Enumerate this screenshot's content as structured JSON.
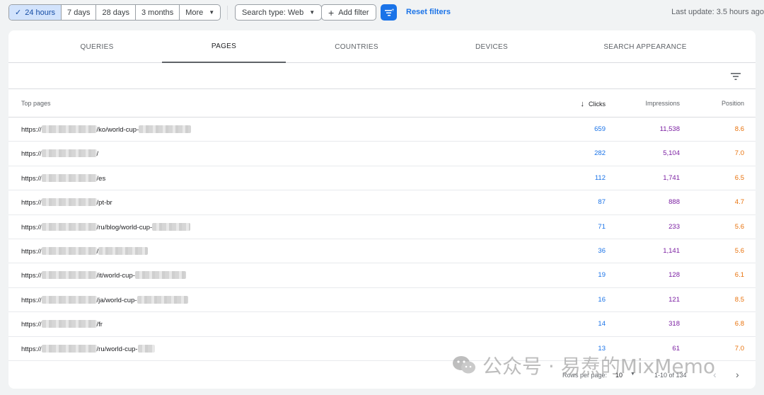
{
  "date_range": {
    "options": [
      {
        "label": "24 hours",
        "active": true
      },
      {
        "label": "7 days",
        "active": false
      },
      {
        "label": "28 days",
        "active": false
      },
      {
        "label": "3 months",
        "active": false
      },
      {
        "label": "More",
        "active": false
      }
    ]
  },
  "filters": {
    "search_type": "Search type: Web",
    "add_filter": "Add filter",
    "reset": "Reset filters",
    "last_update": "Last update: 3.5 hours ago"
  },
  "tabs": [
    {
      "label": "QUERIES",
      "active": false
    },
    {
      "label": "PAGES",
      "active": true
    },
    {
      "label": "COUNTRIES",
      "active": false
    },
    {
      "label": "DEVICES",
      "active": false
    },
    {
      "label": "SEARCH APPEARANCE",
      "active": false
    }
  ],
  "table": {
    "headers": {
      "page": "Top pages",
      "clicks": "Clicks",
      "impressions": "Impressions",
      "position": "Position"
    },
    "rows": [
      {
        "prefix": "https://",
        "path": "/ko/world-cup-",
        "clicks": "659",
        "impressions": "11,538",
        "position": "8.6"
      },
      {
        "prefix": "https://",
        "path": "/",
        "clicks": "282",
        "impressions": "5,104",
        "position": "7.0"
      },
      {
        "prefix": "https://",
        "path": "/es",
        "clicks": "112",
        "impressions": "1,741",
        "position": "6.5"
      },
      {
        "prefix": "https://",
        "path": "/pt-br",
        "clicks": "87",
        "impressions": "888",
        "position": "4.7"
      },
      {
        "prefix": "https://",
        "path": "/ru/blog/world-cup-",
        "clicks": "71",
        "impressions": "233",
        "position": "5.6"
      },
      {
        "prefix": "https://",
        "path": "/",
        "clicks": "36",
        "impressions": "1,141",
        "position": "5.6"
      },
      {
        "prefix": "https://",
        "path": "/it/world-cup-",
        "clicks": "19",
        "impressions": "128",
        "position": "6.1"
      },
      {
        "prefix": "https://",
        "path": "/ja/world-cup-",
        "clicks": "16",
        "impressions": "121",
        "position": "8.5"
      },
      {
        "prefix": "https://",
        "path": "/fr",
        "clicks": "14",
        "impressions": "318",
        "position": "6.8"
      },
      {
        "prefix": "https://",
        "path": "/ru/world-cup-",
        "clicks": "13",
        "impressions": "61",
        "position": "7.0"
      }
    ]
  },
  "pagination": {
    "rows_per_page_label": "Rows per page:",
    "rows_per_page": "10",
    "range": "1-10 of 134"
  },
  "watermark": {
    "text": "公众号 · 易焘的MixMemo"
  },
  "colors": {
    "accent": "#1a73e8",
    "clicks": "#1a73e8",
    "impressions": "#7b1fa2",
    "position": "#e8710a"
  }
}
